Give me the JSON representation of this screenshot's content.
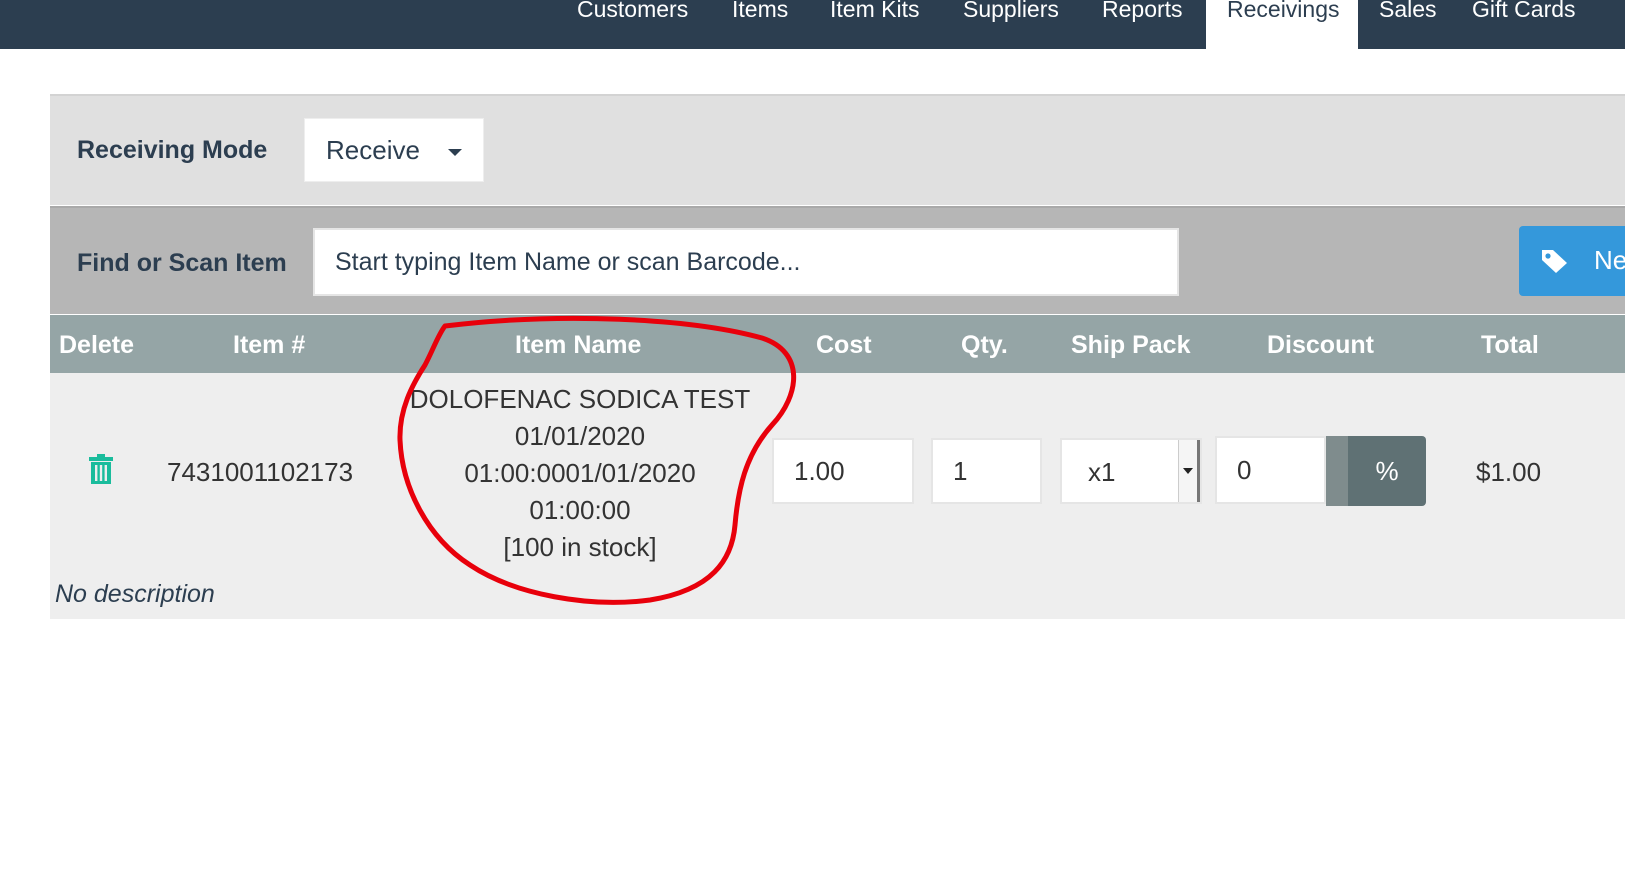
{
  "nav": {
    "items": [
      {
        "label": "Customers"
      },
      {
        "label": "Items"
      },
      {
        "label": "Item Kits"
      },
      {
        "label": "Suppliers"
      },
      {
        "label": "Reports"
      },
      {
        "label": "Receivings",
        "active": true
      },
      {
        "label": "Sales"
      },
      {
        "label": "Gift Cards"
      }
    ]
  },
  "mode_panel": {
    "label": "Receiving Mode",
    "selected": "Receive"
  },
  "find_panel": {
    "label": "Find or Scan Item",
    "placeholder": "Start typing Item Name or scan Barcode...",
    "new_item_label": "New Item",
    "new_item_icon": "tag-icon"
  },
  "table": {
    "headers": {
      "delete": "Delete",
      "item_number": "Item #",
      "item_name": "Item Name",
      "cost": "Cost",
      "qty": "Qty.",
      "ship_pack": "Ship Pack",
      "discount": "Discount",
      "total": "Total"
    },
    "rows": [
      {
        "delete_icon": "trash-icon",
        "item_number": "7431001102173",
        "item_name_lines": [
          "DOLOFENAC SODICA TEST",
          "01/01/2020",
          "01:00:0001/01/2020",
          "01:00:00",
          "[100 in stock]"
        ],
        "cost": "1.00",
        "qty": "1",
        "ship_pack": "x1",
        "discount": "0",
        "discount_type": "%",
        "total": "$1.00",
        "description": "No description"
      }
    ]
  },
  "colors": {
    "nav_bg": "#2c3e50",
    "header_bg": "#95a5a6",
    "new_item_button": "#3498db",
    "trash_icon": "#1abc9c",
    "annotation": "#e8000b"
  }
}
